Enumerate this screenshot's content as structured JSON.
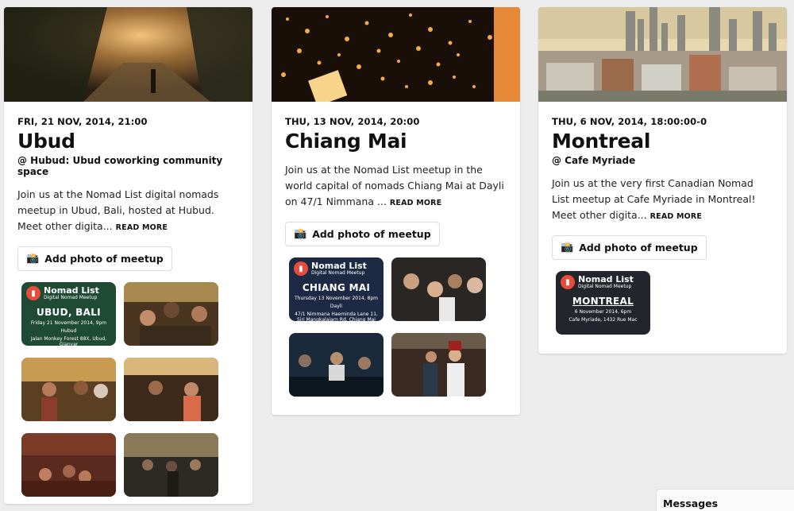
{
  "colors": {
    "background": "#ececec",
    "card": "#ffffff",
    "accent": "#e74c3c"
  },
  "cards": [
    {
      "date": "FRI, 21 NOV, 2014, 21:00",
      "city": "Ubud",
      "venue": "@ Hubud: Ubud coworking community space",
      "description": "Join us at the Nomad List digital nomads meetup in Ubud, Bali, hosted at Hubud. Meet other digita...",
      "read_more": "READ MORE",
      "add_photo": "Add photo of meetup",
      "poster": {
        "brand": "Nomad List",
        "subtitle": "Digital Nomad Meetup",
        "city": "UBUD, BALI",
        "date": "Friday 21 November 2014, 9pm",
        "venue": "Hubud",
        "address": "Jalan Monkey Forest 88X, Ubud, Gianyar"
      }
    },
    {
      "date": "THU, 13 NOV, 2014, 20:00",
      "city": "Chiang Mai",
      "venue": "",
      "description": "Join us at the Nomad List meetup in the world capital of nomads Chiang Mai at Dayli on 47/1 Nimmana ...",
      "read_more": "READ MORE",
      "add_photo": "Add photo of meetup",
      "poster": {
        "brand": "Nomad List",
        "subtitle": "Digital Nomad Meetup",
        "city": "CHIANG MAI",
        "date": "Thursday 13 November 2014, 8pm",
        "venue": "Dayli",
        "address": "47/1 Nimmana Haeminda Lane 11, Siri Mangkalajarn Rd, Chiang Mai"
      }
    },
    {
      "date": "THU, 6 NOV, 2014, 18:00:00-0",
      "city": "Montreal",
      "venue": "@ Cafe Myriade",
      "description": "Join us at the very first Canadian Nomad List meetup at Cafe Myriade in Montreal! Meet other digita...",
      "read_more": "READ MORE",
      "add_photo": "Add photo of meetup",
      "poster": {
        "brand": "Nomad List",
        "subtitle": "Digital Nomad Meetup",
        "city": "MONTREAL",
        "date": "6 November 2014, 6pm",
        "address": "Cafe Myriade, 1432 Rue Mac"
      }
    }
  ],
  "icons": {
    "camera": "camera-icon",
    "pin": "map-pin-icon"
  },
  "messages": {
    "label": "Messages"
  }
}
